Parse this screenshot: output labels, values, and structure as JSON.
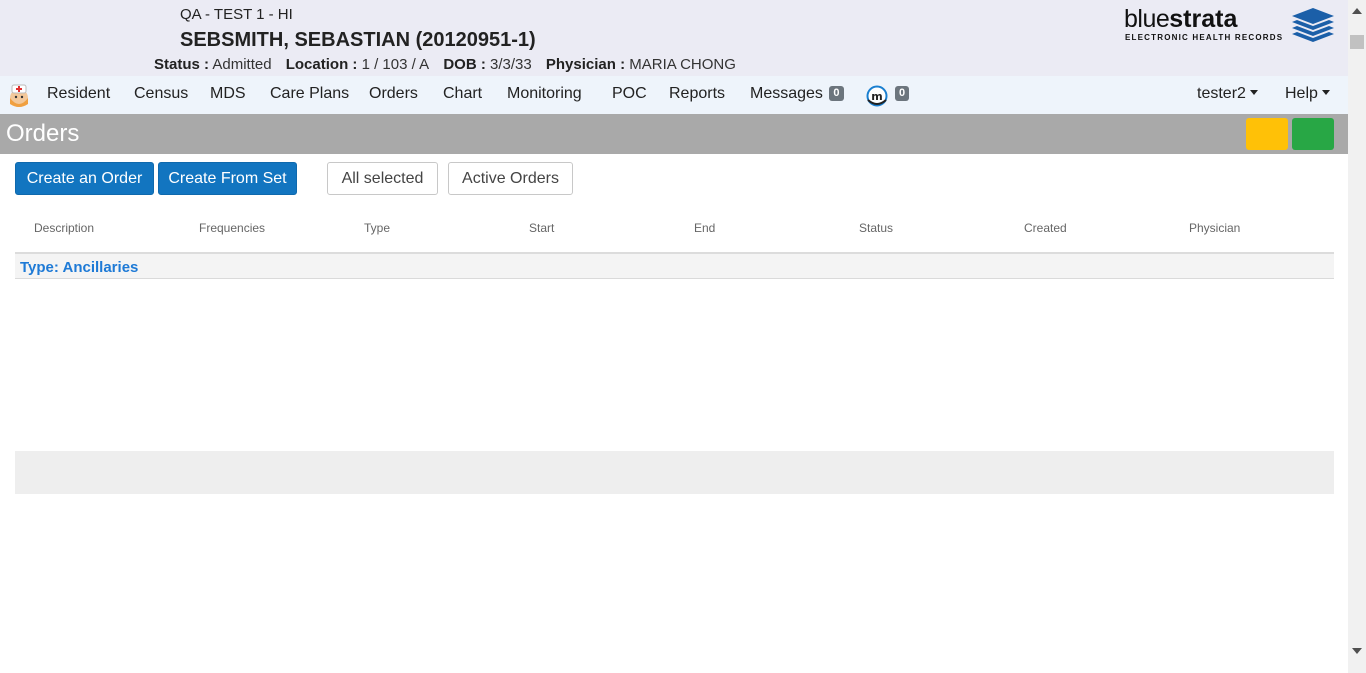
{
  "header": {
    "facility": "QA - TEST 1 - HI",
    "patient_name": "SEBSMITH, SEBASTIAN (20120951-1)",
    "status_label": "Status :",
    "status_value": "Admitted",
    "location_label": "Location :",
    "location_value": "1 / 103 / A",
    "dob_label": "DOB :",
    "dob_value": "3/3/33",
    "physician_label": "Physician :",
    "physician_value": "MARIA CHONG"
  },
  "logo": {
    "word_light": "blue",
    "word_bold": "strata",
    "tagline": "ELECTRONIC HEALTH RECORDS",
    "stack_color": "#1b5fa8"
  },
  "nav": {
    "items": [
      "Resident",
      "Census",
      "MDS",
      "Care Plans",
      "Orders",
      "Chart",
      "Monitoring",
      "POC",
      "Reports"
    ],
    "messages_label": "Messages",
    "messages_count": "0",
    "m_count": "0",
    "user_label": "tester2",
    "help_label": "Help"
  },
  "page": {
    "title": "Orders",
    "status_colors": {
      "yellow": "#ffc107",
      "green": "#28a745"
    }
  },
  "toolbar": {
    "create_order": "Create an Order",
    "create_from_set": "Create From Set",
    "filter_selected": "All selected",
    "active_orders": "Active Orders"
  },
  "table": {
    "columns": [
      "Description",
      "Frequencies",
      "Type",
      "Start",
      "End",
      "Status",
      "Created",
      "Physician"
    ],
    "group_label": "Type: Ancillaries"
  }
}
